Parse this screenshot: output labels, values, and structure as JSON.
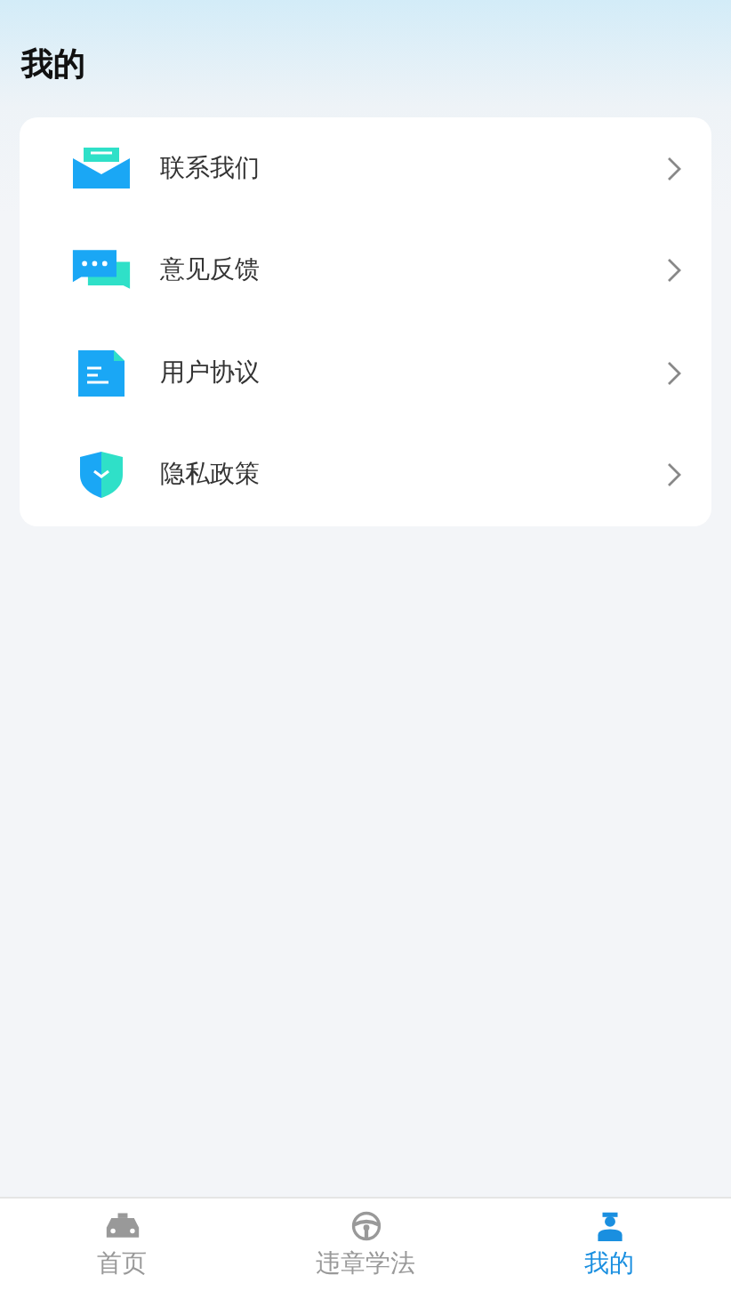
{
  "header": {
    "title": "我的"
  },
  "menu": [
    {
      "kind": "mail",
      "label": "联系我们"
    },
    {
      "kind": "chat",
      "label": "意见反馈"
    },
    {
      "kind": "doc",
      "label": "用户协议"
    },
    {
      "kind": "shield",
      "label": "隐私政策"
    }
  ],
  "tabs": [
    {
      "kind": "car",
      "label": "首页",
      "selected": false
    },
    {
      "kind": "wheel",
      "label": "违章学法",
      "selected": false
    },
    {
      "kind": "user",
      "label": "我的",
      "selected": true
    }
  ]
}
